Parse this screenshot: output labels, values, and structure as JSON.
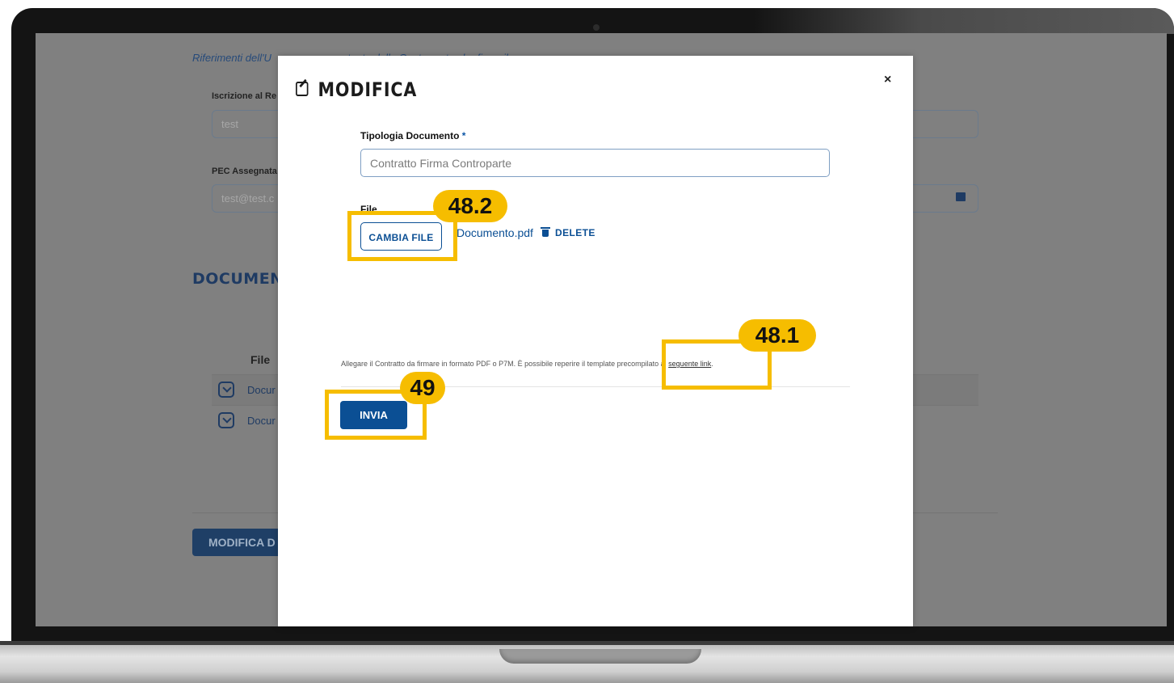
{
  "background_page": {
    "section_caption": "Riferimenti dell'U",
    "caption_partial_right": "tente della Controparte che firma il Contratto",
    "iscrizione_label": "Iscrizione al Re",
    "iscrizione_value": "test",
    "pec_label": "PEC Assegnata",
    "pec_value": "test@test.c",
    "documents_heading": "DOCUMENTI",
    "table_header_file": "File",
    "rows": [
      "Docur",
      "Docur"
    ],
    "modify_button": "MODIFICA D"
  },
  "modal": {
    "title": "MODIFICA",
    "close": "×",
    "tipologia_label": "Tipologia Documento",
    "required_mark": "*",
    "tipologia_placeholder": "Contratto Firma Controparte",
    "file_label": "File",
    "change_file_button": "CAMBIA FILE",
    "file_name": "Documento.pdf",
    "delete_label": "DELETE",
    "hint_text": "Allegare il Contratto da firmare in formato PDF o P7M. È possibile reperire il template precompilato al ",
    "hint_link": "seguente link",
    "hint_end": ".",
    "submit_button": "INVIA"
  },
  "annotations": {
    "a1": "48.2",
    "a2": "48.1",
    "a3": "49",
    "color": "#f6bd00"
  },
  "colors": {
    "primary": "#0b4f94",
    "overlay": "#808080"
  }
}
